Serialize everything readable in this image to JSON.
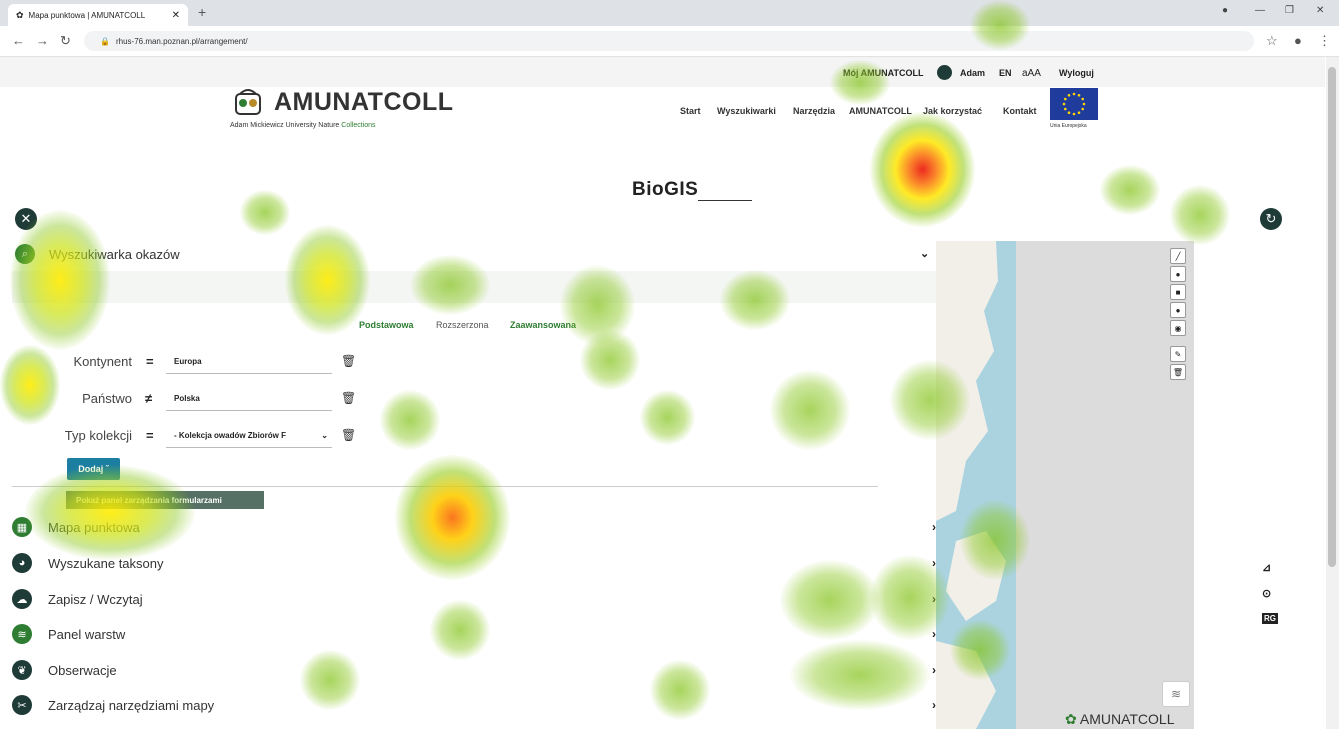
{
  "browser": {
    "tab_title": "Mapa punktowa | AMUNATCOLL",
    "tab_close": "✕",
    "new_tab": "+",
    "url": "rhus-76.man.poznan.pl/arrangement/",
    "win_controls": [
      "—",
      "❐",
      "✕"
    ]
  },
  "user_bar": {
    "my_account": "Mój AMUNATCOLL",
    "user_name": "Adam",
    "lang": "EN",
    "font_size": "aAA",
    "logout": "Wyloguj"
  },
  "logo": {
    "title": "AMUNATCOLL",
    "subtitle_part1": "Adam Mickiewicz University Nature",
    "subtitle_part2": "Collections"
  },
  "nav": {
    "items": [
      "Start",
      "Wyszukiwarki",
      "Narzędzia",
      "AMUNATCOLL",
      "Jak korzystać",
      "Kontakt"
    ],
    "eu_label": "Unia Europejska"
  },
  "page_title": "BioGIS",
  "search_panel": {
    "title": "Wyszukiwarka okazów",
    "modes": [
      "Podstawowa",
      "Rozszerzona",
      "Zaawansowana"
    ],
    "filters": [
      {
        "label": "Kontynent",
        "operator": "=",
        "value": "Europa"
      },
      {
        "label": "Państwo",
        "operator": "≠",
        "value": "Polska"
      },
      {
        "label": "Typ kolekcji",
        "operator": "=",
        "value": "- Kolekcja owadów Zbiorów F"
      }
    ],
    "add_button": "Dodaj ˇ",
    "tooltip": "Pokaż panel zarządzania formularzami"
  },
  "accordion": [
    {
      "label": "Mapa punktowa",
      "icon": "map-icon"
    },
    {
      "label": "Wyszukane taksony",
      "icon": "palette-icon"
    },
    {
      "label": "Zapisz / Wczytaj",
      "icon": "cloud-upload-icon"
    },
    {
      "label": "Panel warstw",
      "icon": "layers-icon"
    },
    {
      "label": "Obserwacje",
      "icon": "leaf-icon"
    },
    {
      "label": "Zarządzaj narzędziami mapy",
      "icon": "tools-icon"
    }
  ],
  "map": {
    "logo_text": "AMUNATCOLL",
    "tools": [
      "line-tool",
      "point-tool",
      "square-tool",
      "circle-tool",
      "marker-tool",
      "edit-tool",
      "delete-tool"
    ]
  },
  "right_tools": [
    "⊿",
    "⊙",
    "RG"
  ],
  "colors": {
    "brand_green": "#2e7d32",
    "dark_icon": "#1f3b37",
    "button_blue": "#1c7ea0",
    "map_water": "#aad3df"
  }
}
